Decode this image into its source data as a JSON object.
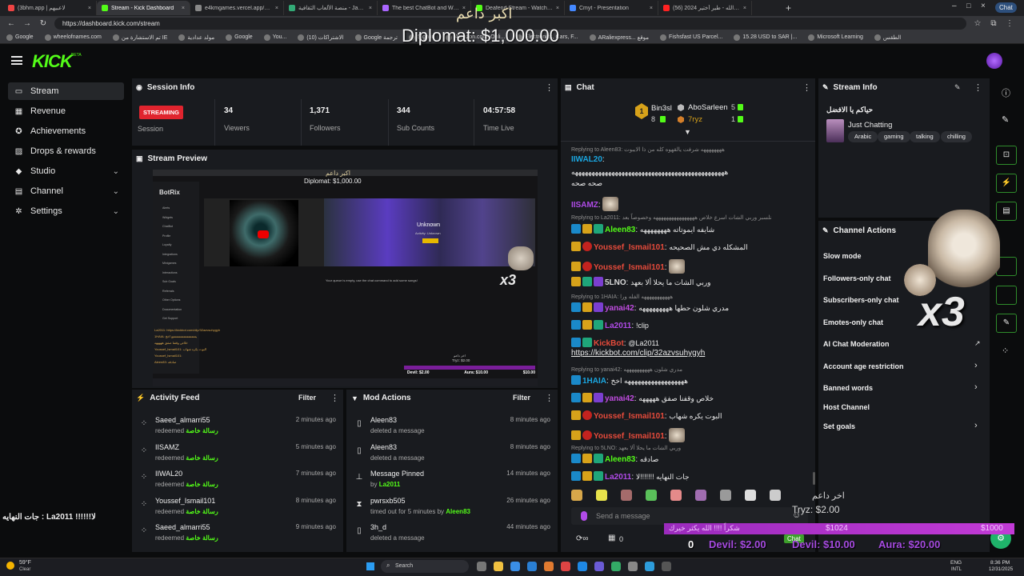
{
  "browser": {
    "tabs": [
      {
        "label": "(3bhm.app | لاعبيهم",
        "active": false,
        "color": "#e44"
      },
      {
        "label": "Stream - Kick Dashboard",
        "active": true,
        "color": "#53fc18"
      },
      {
        "label": "e4kmgames.vercel.app/games/wh...",
        "active": false,
        "color": "#888"
      },
      {
        "label": "منصة الألعاب الثقافية - Jawlah | جولة",
        "active": false,
        "color": "#3a7"
      },
      {
        "label": "The best ChatBot and Widgets fo...",
        "active": false,
        "color": "#a6f"
      },
      {
        "label": "Deafend Stream - Watch Live...",
        "active": false,
        "color": "#53fc18"
      },
      {
        "label": "Cmyt - Presentation",
        "active": false,
        "color": "#48f"
      },
      {
        "label": "(56) زيد عبدالله - طير أختير 2024 |",
        "active": false,
        "color": "#f22"
      }
    ],
    "url": "https://dashboard.kick.com/stream",
    "bookmarks": [
      "Google",
      "wheelofnames.com",
      "تم الاستشارة من IE",
      "مولد عدادية",
      "Google",
      "You...",
      "(10) الاشتراكات",
      "Google ترجمة",
      "Sign in",
      "Amazon.com: Onli...",
      "Electronics, Cars, F...",
      "ARaliexpress... موقع",
      "Fishsfast US Parcel...",
      "15.28 USD to SAR |...",
      "Microsoft Learning",
      "الطقس"
    ]
  },
  "kick": {
    "logo": "KICK",
    "beta": "BETA"
  },
  "sidebar": {
    "items": [
      {
        "label": "Stream",
        "icon": "stream-icon",
        "active": true,
        "expandable": false
      },
      {
        "label": "Revenue",
        "icon": "revenue-icon",
        "active": false,
        "expandable": false
      },
      {
        "label": "Achievements",
        "icon": "trophy-icon",
        "active": false,
        "expandable": false
      },
      {
        "label": "Drops & rewards",
        "icon": "gift-icon",
        "active": false,
        "expandable": false
      },
      {
        "label": "Studio",
        "icon": "studio-icon",
        "active": false,
        "expandable": true
      },
      {
        "label": "Channel",
        "icon": "channel-icon",
        "active": false,
        "expandable": true
      },
      {
        "label": "Settings",
        "icon": "gear-icon",
        "active": false,
        "expandable": true
      }
    ]
  },
  "session": {
    "title": "Session Info",
    "status": "STREAMING",
    "status_label": "Session",
    "stats": [
      {
        "value": "34",
        "label": "Viewers"
      },
      {
        "value": "1,371",
        "label": "Followers"
      },
      {
        "value": "344",
        "label": "Sub Counts"
      },
      {
        "value": "04:57:58",
        "label": "Time Live"
      }
    ]
  },
  "preview": {
    "title": "Stream Preview",
    "overlay_arabic": "اكبر داعم",
    "overlay_amount": "Diplomat: $1,000.00",
    "botrix_label": "BotRix",
    "menu": [
      "Alerts",
      "Widgets",
      "ChatBot",
      "Profile",
      "Loyalty",
      "Integrations",
      "Minigames",
      "Interactions",
      "Sub Goals",
      "Referrals",
      "Other Options",
      "Documentation",
      "Get Support"
    ],
    "player_title": "Unknown",
    "player_sub": "Activity: Unknown",
    "queue_text": "Your queue is empty, use the chat command to add some songs!",
    "mini_chat": [
      "La2011: https://kickbot.com/clip/32azvsuhygyh",
      "1HAIA: يعععععععععععععععع اخخ",
      "خلاص وقفنا صفق هههههه",
      "Youssef_Ismail101: البوت يكره شهاب",
      "Youssef_Ismail101:",
      "Aleen83: صادقه"
    ],
    "mini_ticker": [
      "Devil: $2.00",
      "Aura: $10.00",
      "$10.00"
    ],
    "mini_last": "Tryz: $2.00",
    "mini_last_ar": "اخر داعم",
    "x3": "x3"
  },
  "activity": {
    "title": "Activity Feed",
    "filter": "Filter",
    "items": [
      {
        "name": "Saeed_almarri55",
        "action": "redeemed",
        "reward": "رسالة خاصة",
        "time": "2 minutes ago"
      },
      {
        "name": "IISAMZ",
        "action": "redeemed",
        "reward": "رسالة خاصة",
        "time": "5 minutes ago"
      },
      {
        "name": "IIWAL20",
        "action": "redeemed",
        "reward": "رسالة خاصة",
        "time": "7 minutes ago"
      },
      {
        "name": "Youssef_Ismail101",
        "action": "redeemed",
        "reward": "رسالة خاصة",
        "time": "8 minutes ago"
      },
      {
        "name": "Saeed_almarri55",
        "action": "redeemed",
        "reward": "رسالة خاصة",
        "time": "9 minutes ago"
      }
    ]
  },
  "mod": {
    "title": "Mod Actions",
    "filter": "Filter",
    "items": [
      {
        "name": "Aleen83",
        "desc": "deleted a message",
        "by": "",
        "time": "8 minutes ago",
        "icon": "trash-icon"
      },
      {
        "name": "Aleen83",
        "desc": "deleted a message",
        "by": "",
        "time": "8 minutes ago",
        "icon": "trash-icon"
      },
      {
        "name": "Message Pinned",
        "desc": "by",
        "by": "La2011",
        "time": "14 minutes ago",
        "icon": "pin-icon"
      },
      {
        "name": "pwrsxb505",
        "desc": "timed out for 5 minutes by",
        "by": "Aleen83",
        "time": "26 minutes ago",
        "icon": "hourglass-icon"
      },
      {
        "name": "3h_d",
        "desc": "deleted a message",
        "by": "",
        "time": "44 minutes ago",
        "icon": "trash-icon"
      }
    ]
  },
  "chat": {
    "title": "Chat",
    "leaderboard": [
      {
        "name": "Bin3sl",
        "count": "8"
      },
      {
        "name": "AboSarleen",
        "count": "5"
      },
      {
        "name": "7ryz",
        "count": "1"
      }
    ],
    "messages": [
      {
        "kind": "reply",
        "text": "Replying to Aleen83: ههههههههه شرفت يالقهوه كله من ذا الايبوت"
      },
      {
        "kind": "msg",
        "user": "IIWAL20",
        "color": "#1aa6e0",
        "text": ""
      },
      {
        "kind": "cont",
        "text": "ههههههههههههههههههههههههههههههههههههههههههههههه"
      },
      {
        "kind": "cont",
        "text": "صحه صحه"
      },
      {
        "kind": "msg",
        "user": "IISAMZ",
        "color": "#b04be8",
        "text": ""
      },
      {
        "kind": "reply",
        "text": "Replying to La2011: نلسبر وربي الشات اسرع خلاص ههههههههههههههههه وخصوصاً بعد"
      },
      {
        "kind": "msg",
        "user": "Aleen83",
        "color": "#53fc18",
        "text": "شايفه ايموتاته ههههههههه"
      },
      {
        "kind": "msg",
        "user": "Youssef_Ismail101",
        "color": "#e64b3b",
        "text": "المشكله دي مش الصحيحه"
      },
      {
        "kind": "msg",
        "user": "Youssef_Ismail101",
        "color": "#e64b3b",
        "text": ""
      },
      {
        "kind": "msg",
        "user": "5LNO",
        "color": "#d8d8d8",
        "text": "وربي الشات ما يحلا ألا بعهد"
      },
      {
        "kind": "reply",
        "text": "Replying to 1HAIA: هههههههههههه الفله ورا"
      },
      {
        "kind": "msg",
        "user": "yanai42",
        "color": "#c04ce0",
        "text": "مدري شلون حطها هههههههههه"
      },
      {
        "kind": "msg",
        "user": "La2011",
        "color": "#b04be8",
        "text": "!clip"
      },
      {
        "kind": "msg",
        "user": "KickBot",
        "color": "#e64b3b",
        "text": "@La2011"
      },
      {
        "kind": "link",
        "text": "https://kickbot.com/clip/32azvsuhygyh"
      },
      {
        "kind": "reply",
        "text": "Replying to yanai42: مدري شلون ههههههههههه"
      },
      {
        "kind": "msg",
        "user": "1HAIA",
        "color": "#1aa6e0",
        "text": "ههههههههههههههههههه اخخ"
      },
      {
        "kind": "msg",
        "user": "yanai42",
        "color": "#c04ce0",
        "text": "خلاص وقفنا صفق هههههه"
      },
      {
        "kind": "msg",
        "user": "Youssef_Ismail101",
        "color": "#e64b3b",
        "text": "البوت يكره شهاب"
      },
      {
        "kind": "msg",
        "user": "Youssef_Ismail101",
        "color": "#e64b3b",
        "text": ""
      },
      {
        "kind": "reply",
        "text": "Replying to 5LNO: وربي الشات ما يحلا ألا بعهد"
      },
      {
        "kind": "msg",
        "user": "Aleen83",
        "color": "#53fc18",
        "text": "صادقه"
      },
      {
        "kind": "msg",
        "user": "La2011",
        "color": "#b04be8",
        "text": "جات النهايه !!!!!!!لا"
      }
    ],
    "placeholder": "Send a message",
    "points": "0",
    "chat_button": "Chat"
  },
  "streaminfo": {
    "title": "Stream Info",
    "stream_title": "حياكم يا الافضل",
    "category": "Just Chatting",
    "tags": [
      "Arabic",
      "gaming",
      "talking",
      "chilling"
    ]
  },
  "actions": {
    "title": "Channel Actions",
    "items": [
      {
        "label": "Slow mode",
        "chev": false
      },
      {
        "label": "Followers-only chat",
        "chev": false
      },
      {
        "label": "Subscribers-only chat",
        "chev": false
      },
      {
        "label": "Emotes-only chat",
        "chev": false
      },
      {
        "label": "AI Chat Moderation",
        "chev": false,
        "external": true
      },
      {
        "label": "Account age restriction",
        "chev": true
      },
      {
        "label": "Banned words",
        "chev": true
      },
      {
        "label": "Host Channel",
        "chev": false
      },
      {
        "label": "Set goals",
        "chev": true
      }
    ]
  },
  "overlays": {
    "top_arabic": "اكبر داعم",
    "top_amount": "Diplomat: $1,000.00",
    "left_chat": "جات النهايه : La2011 !!!!!!لا",
    "last_label": "اخر داعم",
    "last_amount": "Tryz: $2.00",
    "x3": "x3",
    "goal_text": "شكراً !!!! الله يكثر خيرك",
    "goal_current": "$1024",
    "goal_target": "$1000",
    "ticker": [
      "0",
      "Devil: $2.00",
      "Devil: $10.00",
      "Aura: $20.00"
    ]
  },
  "taskbar": {
    "weather_temp": "59°F",
    "weather_desc": "Clear",
    "search": "Search",
    "lang": "ENG",
    "lang2": "INTL",
    "time": "8:36 PM",
    "date": "12/31/2025"
  },
  "colors": {
    "kick_green": "#53fc18",
    "streaming_red": "#e0242e",
    "panel": "#191b1f",
    "background": "#0b0c0d"
  }
}
